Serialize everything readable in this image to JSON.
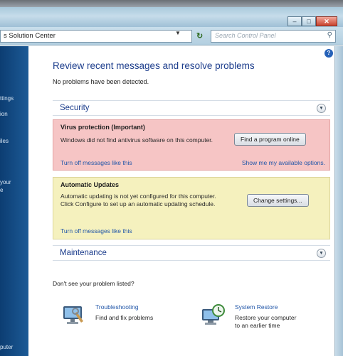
{
  "window": {
    "minimize_glyph": "–",
    "maximize_glyph": "□",
    "close_glyph": "✕"
  },
  "address_bar": {
    "path": "s Solution Center",
    "search_placeholder": "Search Control Panel",
    "search_icon": "search-icon",
    "refresh_icon": "refresh-icon"
  },
  "sidebar": {
    "items": [
      {
        "label": "ttings"
      },
      {
        "label": "ion"
      },
      {
        "label": "iles"
      },
      {
        "label": "your"
      },
      {
        "label": "e"
      },
      {
        "label": "puter"
      }
    ]
  },
  "main": {
    "title": "Review recent messages and resolve problems",
    "subtitle": "No problems have been detected.",
    "security": {
      "title": "Security"
    },
    "virus": {
      "heading": "Virus protection  (Important)",
      "body": "Windows did not find antivirus software on this computer.",
      "link_left": "Turn off messages like this",
      "link_right": "Show me my available options.",
      "button": "Find a program online"
    },
    "updates": {
      "heading": "Automatic Updates",
      "body": "Automatic updating is not yet configured for this computer. Click Configure to set up an automatic updating schedule.",
      "link": "Turn off messages like this",
      "button": "Change settings..."
    },
    "maintenance": {
      "title": "Maintenance"
    },
    "question": "Don't see your problem listed?",
    "troubleshooting": {
      "title": "Troubleshooting",
      "desc": "Find and fix problems"
    },
    "system_restore": {
      "title": "System Restore",
      "desc": "Restore your computer to an earlier time"
    }
  },
  "colors": {
    "sidebar": "#154b84",
    "link": "#2156a8",
    "heading": "#1c3d8c",
    "alert_red": "#f6c5c5",
    "alert_yellow": "#f5f1be"
  }
}
